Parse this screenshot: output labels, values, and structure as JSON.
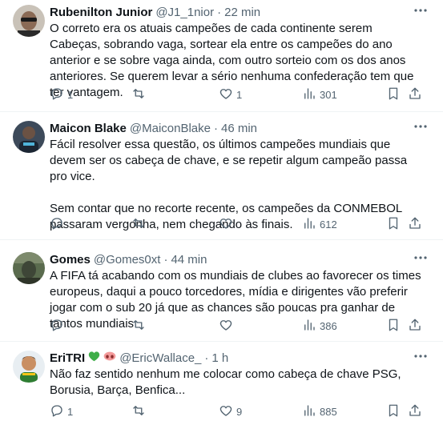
{
  "tweets": [
    {
      "name": "Rubenilton Junior",
      "handle": "@J1_1nior",
      "dot": "·",
      "time": "22 min",
      "text": "O correto era os atuais campeões de cada continente serem Cabeças, sobrando vaga, sortear ela entre os campeões do ano anterior e se sobre vaga ainda, com outro sorteio com os dos anos anteriores. Se querem levar a sério nenhuma confederação tem que ter vantagem.",
      "replies": "1",
      "retweets": "",
      "likes": "1",
      "views": "301"
    },
    {
      "name": "Maicon Blake",
      "handle": "@MaiconBlake",
      "dot": "·",
      "time": "46 min",
      "text": "Fácil resolver essa questão, os últimos campeões mundiais que devem ser os cabeça de chave, e se repetir algum campeão passa pro vice.\n\nSem contar que no recorte recente, os campeões da CONMEBOL passaram vergonha, nem chegando às finais.",
      "replies": "",
      "retweets": "",
      "likes": "",
      "views": "612"
    },
    {
      "name": "Gomes",
      "handle": "@Gomes0xt",
      "dot": "·",
      "time": "44 min",
      "text": "A FIFA tá acabando com os mundiais de clubes ao favorecer os times europeus, daqui a pouco torcedores, mídia e dirigentes vão preferir jogar com o sub 20 já que as chances são poucas pra ganhar de tantos mundiais",
      "replies": "",
      "retweets": "",
      "likes": "",
      "views": "386"
    },
    {
      "name": "EriTRI",
      "name_emojis": [
        "green-heart",
        "nose-emoji"
      ],
      "handle": "@EricWallace_",
      "dot": "·",
      "time": "1 h",
      "text": "Não faz sentido nenhum me colocar como cabeça de chave PSG, Borusia, Barça, Benfica...",
      "replies": "1",
      "retweets": "",
      "likes": "9",
      "views": "885"
    }
  ],
  "icons": {
    "more": "more-icon",
    "reply": "reply-icon",
    "retweet": "retweet-icon",
    "like": "like-icon",
    "views": "views-icon",
    "bookmark": "bookmark-icon",
    "share": "share-icon"
  },
  "colors": {
    "text": "#0f1419",
    "secondary": "#536471",
    "divider": "#eff3f4",
    "heart_emoji": "#3fae49"
  }
}
